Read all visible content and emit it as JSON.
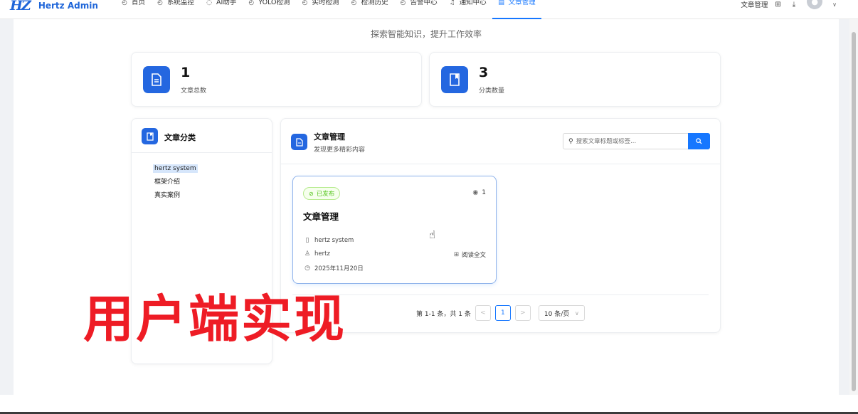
{
  "app": {
    "logo_mark": "HZ",
    "name": "Hertz Admin"
  },
  "nav": {
    "items": [
      {
        "icon": "dashboard-icon",
        "label": "首页",
        "active": false
      },
      {
        "icon": "monitor-icon",
        "label": "系统监控",
        "active": false
      },
      {
        "icon": "chat-icon",
        "label": "AI助手",
        "active": false
      },
      {
        "icon": "detect-icon",
        "label": "YOLO检测",
        "active": false
      },
      {
        "icon": "realtime-icon",
        "label": "实时检测",
        "active": false
      },
      {
        "icon": "history-icon",
        "label": "检测历史",
        "active": false
      },
      {
        "icon": "alarm-icon",
        "label": "告警中心",
        "active": false
      },
      {
        "icon": "bell-icon",
        "label": "通知中心",
        "active": false
      },
      {
        "icon": "article-icon",
        "label": "文章管理",
        "active": true
      }
    ],
    "right_text": "文章管理"
  },
  "tagline": "探索智能知识，提升工作效率",
  "stats": [
    {
      "value": "1",
      "label": "文章总数",
      "icon": "document-icon"
    },
    {
      "value": "3",
      "label": "分类数量",
      "icon": "book-icon"
    }
  ],
  "sidebar": {
    "title": "文章分类",
    "items": [
      {
        "label": "hertz system",
        "selected": true
      },
      {
        "label": "框架介绍",
        "selected": false
      },
      {
        "label": "真实案例",
        "selected": false
      }
    ]
  },
  "articles_panel": {
    "title": "文章管理",
    "subtitle": "发现更多精彩内容",
    "search_placeholder": "搜索文章标题或标签..."
  },
  "article_card": {
    "status": "已发布",
    "views": "1",
    "title": "文章管理",
    "category": "hertz system",
    "author": "hertz",
    "date": "2025年11月20日",
    "read_label": "阅读全文"
  },
  "pagination": {
    "summary": "第 1-1 条，共 1 条",
    "prev": "<",
    "current": "1",
    "next": ">",
    "page_size": "10 条/页"
  },
  "overlay_text": "用户端实现",
  "colors": {
    "primary": "#1677ff",
    "icon_bg": "#2467e0",
    "overlay": "#ee1c25",
    "success": "#52c41a"
  }
}
